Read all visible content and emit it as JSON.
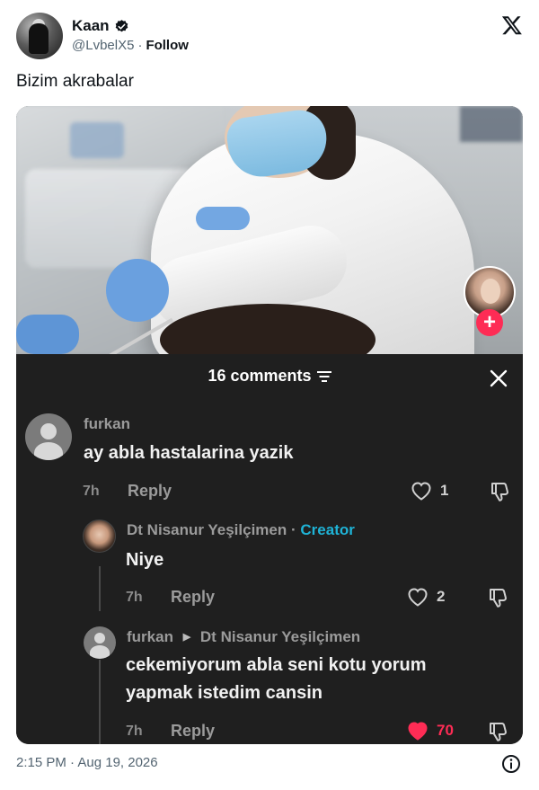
{
  "tweet": {
    "author_name": "Kaan",
    "author_handle": "@LvbelX5",
    "separator": "·",
    "follow_label": "Follow",
    "text": "Bizim akrabalar",
    "timestamp": "2:15 PM · Aug 19, 2026",
    "icons": {
      "verified": "verified-badge-icon",
      "x_logo": "x-logo-icon",
      "info": "info-icon"
    }
  },
  "comments_panel": {
    "title": "16 comments",
    "follow_button_label": "+",
    "comments": [
      {
        "user": "furkan",
        "text_lines": [
          "ay abla hastalarina yazik"
        ],
        "time": "7h",
        "reply_label": "Reply",
        "likes": "1",
        "liked": false
      },
      {
        "user": "Dt Nisanur Yeşilçimen",
        "sep": "·",
        "creator_badge": "Creator",
        "text_lines": [
          "Niye"
        ],
        "time": "7h",
        "reply_label": "Reply",
        "likes": "2",
        "liked": false
      },
      {
        "user": "furkan",
        "reply_to": "Dt Nisanur Yeşilçimen",
        "text_lines": [
          "cekemiyorum abla seni kotu yorum",
          "yapmak istedim cansin"
        ],
        "time": "7h",
        "reply_label": "Reply",
        "likes": "70",
        "liked": true
      }
    ],
    "colors": {
      "panel_bg": "#1f1f1f",
      "creator": "#1fb3d6",
      "liked": "#fe2c55"
    }
  }
}
